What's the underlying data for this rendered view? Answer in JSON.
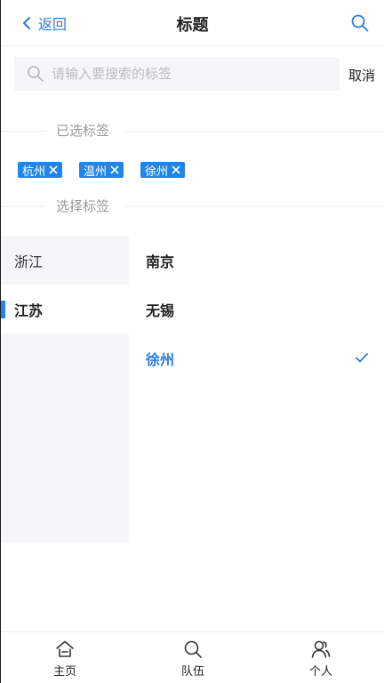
{
  "header": {
    "back_label": "返回",
    "title": "标题"
  },
  "search": {
    "placeholder": "请输入要搜索的标签",
    "value": "",
    "cancel_label": "取消"
  },
  "selected_section": {
    "title": "已选标签",
    "tags": [
      "杭州",
      "温州",
      "徐州"
    ]
  },
  "choose_section": {
    "title": "选择标签"
  },
  "picker": {
    "provinces": [
      {
        "label": "浙江",
        "active": false
      },
      {
        "label": "江苏",
        "active": true
      }
    ],
    "cities": [
      {
        "label": "南京",
        "checked": false
      },
      {
        "label": "无锡",
        "checked": false
      },
      {
        "label": "徐州",
        "checked": true
      }
    ]
  },
  "tabbar": {
    "items": [
      {
        "label": "主页",
        "icon": "home-icon"
      },
      {
        "label": "队伍",
        "icon": "search-icon"
      },
      {
        "label": "个人",
        "icon": "user-icon"
      }
    ]
  },
  "colors": {
    "accent": "#1f86ee",
    "link": "#2a7ae2",
    "muted_text": "#999999",
    "panel_bg": "#f5f6f8"
  }
}
